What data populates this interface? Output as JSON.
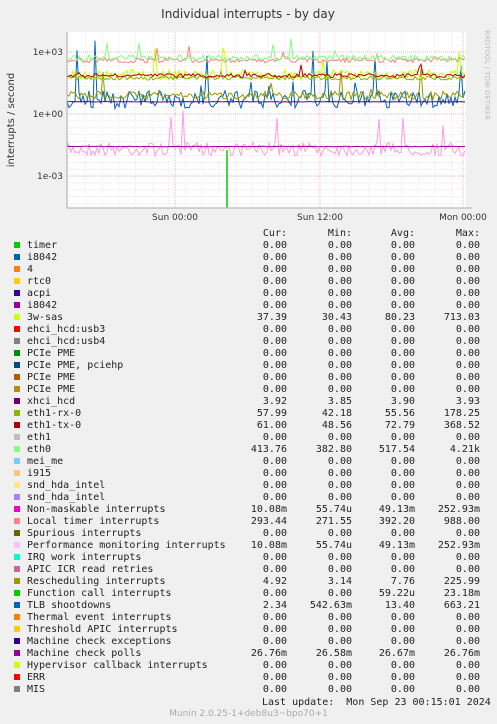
{
  "chart_data": {
    "type": "line",
    "title": "Individual interrupts - by day",
    "ylabel": "interrupts / second",
    "yscale": "log",
    "yticks": [
      "1e+03",
      "1e+00",
      "1e-03"
    ],
    "xticks": [
      "Sun 00:00",
      "Sun 12:00",
      "Mon 00:00"
    ],
    "grid": true,
    "side_label": "RRDTOOL / TOBI OETIKER",
    "legend_headers": [
      "Cur:",
      "Min:",
      "Avg:",
      "Max:"
    ],
    "series": [
      {
        "name": "timer",
        "color": "#00cc00",
        "cur": "0.00",
        "min": "0.00",
        "avg": "0.00",
        "max": "0.00"
      },
      {
        "name": "i8042",
        "color": "#0066b3",
        "cur": "0.00",
        "min": "0.00",
        "avg": "0.00",
        "max": "0.00"
      },
      {
        "name": "4",
        "color": "#ff8000",
        "cur": "0.00",
        "min": "0.00",
        "avg": "0.00",
        "max": "0.00"
      },
      {
        "name": "rtc0",
        "color": "#ffcc00",
        "cur": "0.00",
        "min": "0.00",
        "avg": "0.00",
        "max": "0.00"
      },
      {
        "name": "acpi",
        "color": "#330099",
        "cur": "0.00",
        "min": "0.00",
        "avg": "0.00",
        "max": "0.00"
      },
      {
        "name": "i8042",
        "color": "#990099",
        "cur": "0.00",
        "min": "0.00",
        "avg": "0.00",
        "max": "0.00"
      },
      {
        "name": "3w-sas",
        "color": "#ccff00",
        "cur": "37.39",
        "min": "30.43",
        "avg": "80.23",
        "max": "713.03"
      },
      {
        "name": "ehci_hcd:usb3",
        "color": "#ff0000",
        "cur": "0.00",
        "min": "0.00",
        "avg": "0.00",
        "max": "0.00"
      },
      {
        "name": "ehci_hcd:usb4",
        "color": "#808080",
        "cur": "0.00",
        "min": "0.00",
        "avg": "0.00",
        "max": "0.00"
      },
      {
        "name": "PCIe PME",
        "color": "#008f00",
        "cur": "0.00",
        "min": "0.00",
        "avg": "0.00",
        "max": "0.00"
      },
      {
        "name": "PCIe PME, pciehp",
        "color": "#00487d",
        "cur": "0.00",
        "min": "0.00",
        "avg": "0.00",
        "max": "0.00"
      },
      {
        "name": "PCIe PME",
        "color": "#b35a00",
        "cur": "0.00",
        "min": "0.00",
        "avg": "0.00",
        "max": "0.00"
      },
      {
        "name": "PCIe PME",
        "color": "#b38f00",
        "cur": "0.00",
        "min": "0.00",
        "avg": "0.00",
        "max": "0.00"
      },
      {
        "name": "xhci_hcd",
        "color": "#6b006b",
        "cur": "3.92",
        "min": "3.85",
        "avg": "3.90",
        "max": "3.93"
      },
      {
        "name": "eth1-rx-0",
        "color": "#8fb300",
        "cur": "57.99",
        "min": "42.18",
        "avg": "55.56",
        "max": "178.25"
      },
      {
        "name": "eth1-tx-0",
        "color": "#b30000",
        "cur": "61.00",
        "min": "48.56",
        "avg": "72.79",
        "max": "368.52"
      },
      {
        "name": "eth1",
        "color": "#bebebe",
        "cur": "0.00",
        "min": "0.00",
        "avg": "0.00",
        "max": "0.00"
      },
      {
        "name": "eth0",
        "color": "#80ff80",
        "cur": "413.76",
        "min": "382.80",
        "avg": "517.54",
        "max": "4.21k"
      },
      {
        "name": "mei_me",
        "color": "#80c9ff",
        "cur": "0.00",
        "min": "0.00",
        "avg": "0.00",
        "max": "0.00"
      },
      {
        "name": "i915",
        "color": "#ffc080",
        "cur": "0.00",
        "min": "0.00",
        "avg": "0.00",
        "max": "0.00"
      },
      {
        "name": "snd_hda_intel",
        "color": "#ffe680",
        "cur": "0.00",
        "min": "0.00",
        "avg": "0.00",
        "max": "0.00"
      },
      {
        "name": "snd_hda_intel",
        "color": "#aa80ff",
        "cur": "0.00",
        "min": "0.00",
        "avg": "0.00",
        "max": "0.00"
      },
      {
        "name": "Non-maskable interrupts",
        "color": "#ee00cc",
        "cur": "10.08m",
        "min": "55.74u",
        "avg": "49.13m",
        "max": "252.93m"
      },
      {
        "name": "Local timer interrupts",
        "color": "#ff8080",
        "cur": "293.44",
        "min": "271.55",
        "avg": "392.20",
        "max": "988.00"
      },
      {
        "name": "Spurious interrupts",
        "color": "#666600",
        "cur": "0.00",
        "min": "0.00",
        "avg": "0.00",
        "max": "0.00"
      },
      {
        "name": "Performance monitoring interrupts",
        "color": "#ffbfff",
        "cur": "10.08m",
        "min": "55.74u",
        "avg": "49.13m",
        "max": "252.93m"
      },
      {
        "name": "IRQ work interrupts",
        "color": "#00ffcc",
        "cur": "0.00",
        "min": "0.00",
        "avg": "0.00",
        "max": "0.00"
      },
      {
        "name": "APIC ICR read retries",
        "color": "#cc6699",
        "cur": "0.00",
        "min": "0.00",
        "avg": "0.00",
        "max": "0.00"
      },
      {
        "name": "Rescheduling interrupts",
        "color": "#999900",
        "cur": "4.92",
        "min": "3.14",
        "avg": "7.76",
        "max": "225.99"
      },
      {
        "name": "Function call interrupts",
        "color": "#00cc00",
        "cur": "0.00",
        "min": "0.00",
        "avg": "59.22u",
        "max": "23.18m"
      },
      {
        "name": "TLB shootdowns",
        "color": "#0066b3",
        "cur": "2.34",
        "min": "542.63m",
        "avg": "13.40",
        "max": "663.21"
      },
      {
        "name": "Thermal event interrupts",
        "color": "#ff8000",
        "cur": "0.00",
        "min": "0.00",
        "avg": "0.00",
        "max": "0.00"
      },
      {
        "name": "Threshold APIC interrupts",
        "color": "#ffcc00",
        "cur": "0.00",
        "min": "0.00",
        "avg": "0.00",
        "max": "0.00"
      },
      {
        "name": "Machine check exceptions",
        "color": "#330099",
        "cur": "0.00",
        "min": "0.00",
        "avg": "0.00",
        "max": "0.00"
      },
      {
        "name": "Machine check polls",
        "color": "#990099",
        "cur": "26.76m",
        "min": "26.58m",
        "avg": "26.67m",
        "max": "26.76m"
      },
      {
        "name": "Hypervisor callback interrupts",
        "color": "#ccff00",
        "cur": "0.00",
        "min": "0.00",
        "avg": "0.00",
        "max": "0.00"
      },
      {
        "name": "ERR",
        "color": "#ff0000",
        "cur": "0.00",
        "min": "0.00",
        "avg": "0.00",
        "max": "0.00"
      },
      {
        "name": "MIS",
        "color": "#808080",
        "cur": "0.00",
        "min": "0.00",
        "avg": "0.00",
        "max": "0.00"
      }
    ]
  },
  "footer": {
    "last_update": "Last update:  Mon Sep 23 00:15:01 2024",
    "munin": "Munin 2.0.25-1+deb8u3~bpo70+1"
  }
}
